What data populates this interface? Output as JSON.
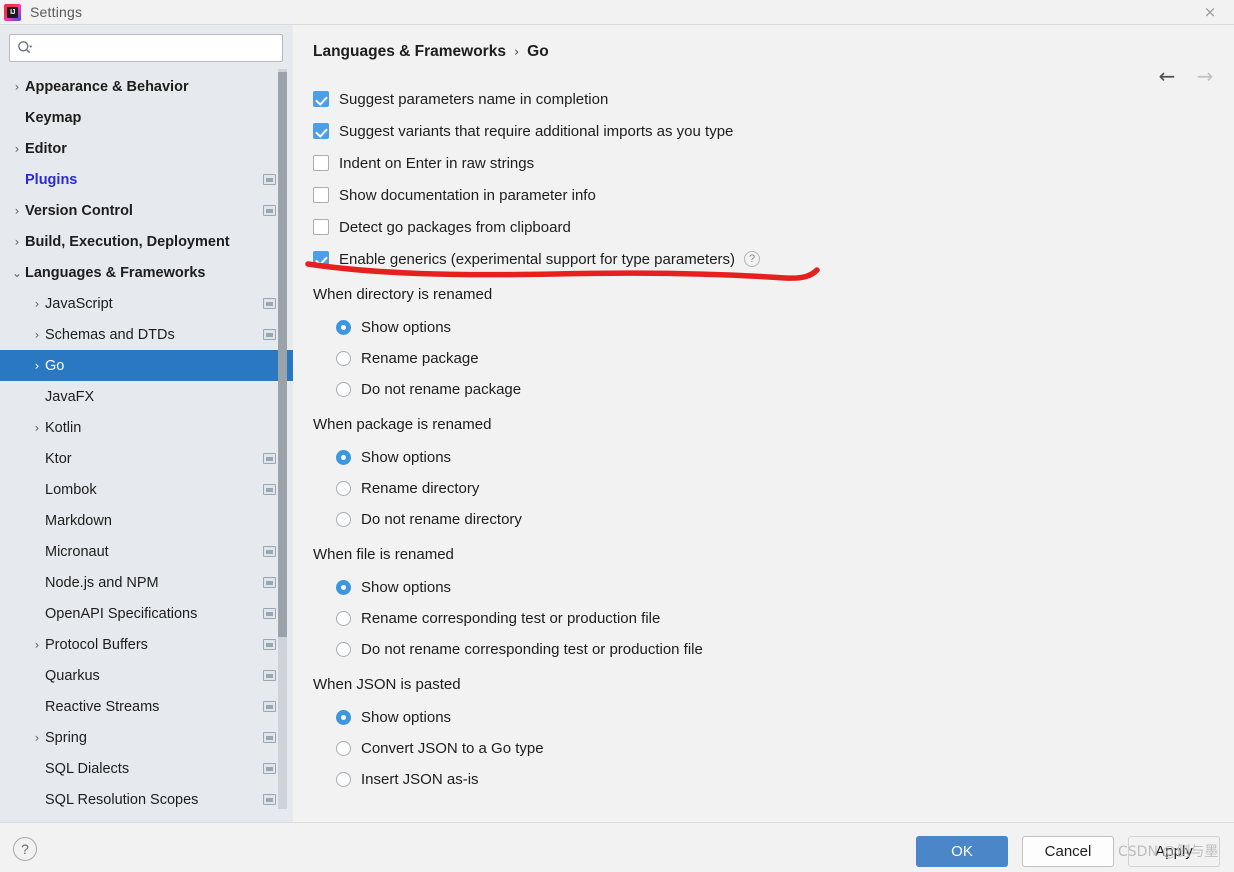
{
  "window": {
    "title": "Settings",
    "logo_icon": "intellij-idea-logo",
    "close_icon": "×"
  },
  "search": {
    "value": "",
    "placeholder": "",
    "icon": "search-icon"
  },
  "sidebar": {
    "items": [
      {
        "label": "Appearance & Behavior",
        "indent": 1,
        "arrow": "›",
        "bold": true,
        "selected": false,
        "scope": false
      },
      {
        "label": "Keymap",
        "indent": 1,
        "arrow": "",
        "bold": true,
        "selected": false,
        "scope": false
      },
      {
        "label": "Editor",
        "indent": 1,
        "arrow": "›",
        "bold": true,
        "selected": false,
        "scope": false
      },
      {
        "label": "Plugins",
        "indent": 1,
        "arrow": "",
        "bold": true,
        "selected": false,
        "scope": true,
        "plugin": true
      },
      {
        "label": "Version Control",
        "indent": 1,
        "arrow": "›",
        "bold": true,
        "selected": false,
        "scope": true
      },
      {
        "label": "Build, Execution, Deployment",
        "indent": 1,
        "arrow": "›",
        "bold": true,
        "selected": false,
        "scope": false
      },
      {
        "label": "Languages & Frameworks",
        "indent": 1,
        "arrow": "⌄",
        "bold": true,
        "selected": false,
        "scope": false,
        "expanded": true
      },
      {
        "label": "JavaScript",
        "indent": 2,
        "arrow": "›",
        "bold": false,
        "selected": false,
        "scope": true
      },
      {
        "label": "Schemas and DTDs",
        "indent": 2,
        "arrow": "›",
        "bold": false,
        "selected": false,
        "scope": true
      },
      {
        "label": "Go",
        "indent": 2,
        "arrow": "›",
        "bold": false,
        "selected": true,
        "scope": false
      },
      {
        "label": "JavaFX",
        "indent": 2,
        "arrow": "",
        "bold": false,
        "selected": false,
        "scope": false
      },
      {
        "label": "Kotlin",
        "indent": 2,
        "arrow": "›",
        "bold": false,
        "selected": false,
        "scope": false
      },
      {
        "label": "Ktor",
        "indent": 2,
        "arrow": "",
        "bold": false,
        "selected": false,
        "scope": true
      },
      {
        "label": "Lombok",
        "indent": 2,
        "arrow": "",
        "bold": false,
        "selected": false,
        "scope": true
      },
      {
        "label": "Markdown",
        "indent": 2,
        "arrow": "",
        "bold": false,
        "selected": false,
        "scope": false
      },
      {
        "label": "Micronaut",
        "indent": 2,
        "arrow": "",
        "bold": false,
        "selected": false,
        "scope": true
      },
      {
        "label": "Node.js and NPM",
        "indent": 2,
        "arrow": "",
        "bold": false,
        "selected": false,
        "scope": true
      },
      {
        "label": "OpenAPI Specifications",
        "indent": 2,
        "arrow": "",
        "bold": false,
        "selected": false,
        "scope": true
      },
      {
        "label": "Protocol Buffers",
        "indent": 2,
        "arrow": "›",
        "bold": false,
        "selected": false,
        "scope": true
      },
      {
        "label": "Quarkus",
        "indent": 2,
        "arrow": "",
        "bold": false,
        "selected": false,
        "scope": true
      },
      {
        "label": "Reactive Streams",
        "indent": 2,
        "arrow": "",
        "bold": false,
        "selected": false,
        "scope": true
      },
      {
        "label": "Spring",
        "indent": 2,
        "arrow": "›",
        "bold": false,
        "selected": false,
        "scope": true
      },
      {
        "label": "SQL Dialects",
        "indent": 2,
        "arrow": "",
        "bold": false,
        "selected": false,
        "scope": true
      },
      {
        "label": "SQL Resolution Scopes",
        "indent": 2,
        "arrow": "",
        "bold": false,
        "selected": false,
        "scope": true
      }
    ]
  },
  "main": {
    "breadcrumb": {
      "parent": "Languages & Frameworks",
      "separator": "›",
      "current": "Go"
    },
    "nav": {
      "back_icon": "arrow-left-icon",
      "back_glyph": "←",
      "forward_icon": "arrow-right-icon",
      "forward_glyph": "→"
    },
    "checkboxes": [
      {
        "label": "Suggest parameters name in completion",
        "checked": true,
        "help": false
      },
      {
        "label": "Suggest variants that require additional imports as you type",
        "checked": true,
        "help": false
      },
      {
        "label": "Indent on Enter in raw strings",
        "checked": false,
        "help": false
      },
      {
        "label": "Show documentation in parameter info",
        "checked": false,
        "help": false
      },
      {
        "label": "Detect go packages from clipboard",
        "checked": false,
        "help": false
      },
      {
        "label": "Enable generics (experimental support for type parameters)",
        "checked": true,
        "help": true,
        "help_glyph": "?"
      }
    ],
    "groups": [
      {
        "title": "When directory is renamed",
        "options": [
          {
            "label": "Show options",
            "selected": true
          },
          {
            "label": "Rename package",
            "selected": false
          },
          {
            "label": "Do not rename package",
            "selected": false
          }
        ]
      },
      {
        "title": "When package is renamed",
        "options": [
          {
            "label": "Show options",
            "selected": true
          },
          {
            "label": "Rename directory",
            "selected": false
          },
          {
            "label": "Do not rename directory",
            "selected": false
          }
        ]
      },
      {
        "title": "When file is renamed",
        "options": [
          {
            "label": "Show options",
            "selected": true
          },
          {
            "label": "Rename corresponding test or production file",
            "selected": false
          },
          {
            "label": "Do not rename corresponding test or production file",
            "selected": false
          }
        ]
      },
      {
        "title": "When JSON is pasted",
        "options": [
          {
            "label": "Show options",
            "selected": true
          },
          {
            "label": "Convert JSON to a Go type",
            "selected": false
          },
          {
            "label": "Insert JSON as-is",
            "selected": false
          }
        ]
      }
    ]
  },
  "footer": {
    "help_glyph": "?",
    "ok_label": "OK",
    "cancel_label": "Cancel",
    "apply_label": "Apply"
  },
  "watermark": {
    "text": "CSDN @侧与墨"
  },
  "colors": {
    "selection_blue": "#2a78c2",
    "checkbox_blue": "#4a9eea",
    "radio_blue": "#3d96e0",
    "primary_button": "#4a86c8",
    "plugin_link": "#2b2bd6",
    "annotation_red": "#e81f1f",
    "sidebar_bg": "#e6eaee",
    "panel_bg": "#f2f2f2"
  }
}
